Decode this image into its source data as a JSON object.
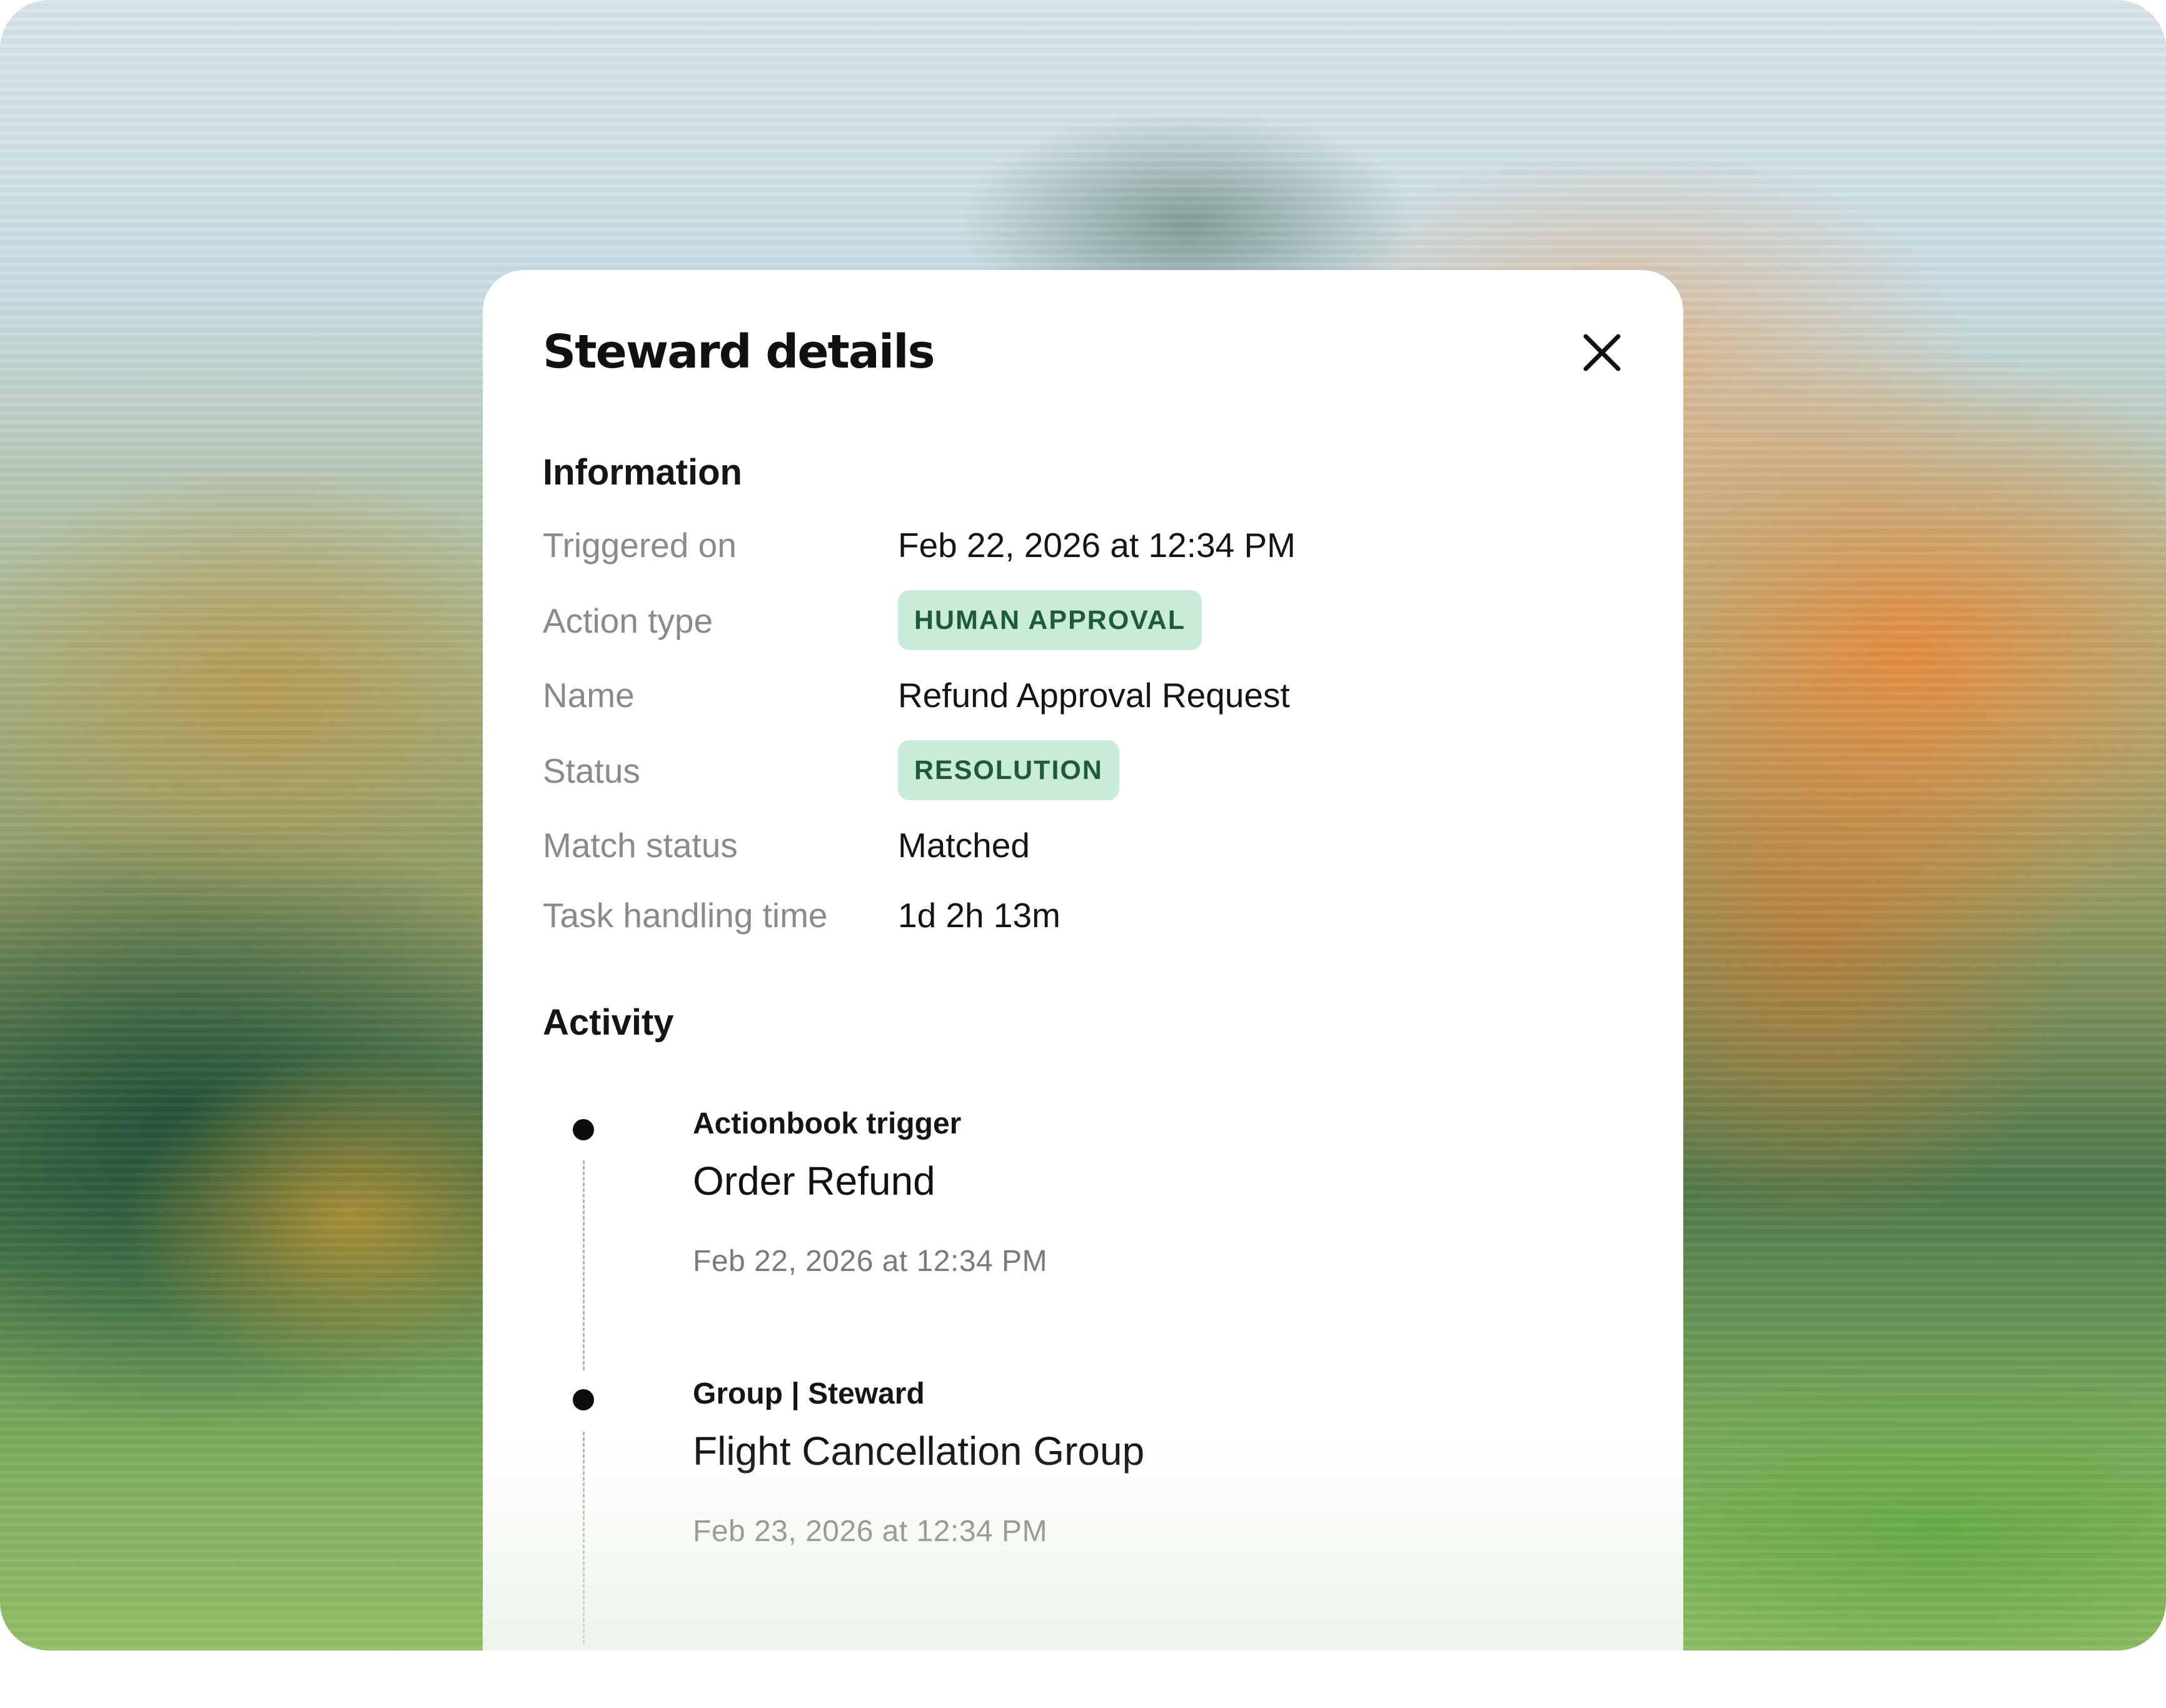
{
  "modal": {
    "title": "Steward details",
    "close_icon": "close-icon"
  },
  "information": {
    "heading": "Information",
    "rows": [
      {
        "label": "Triggered on",
        "value": "Feb 22, 2026 at 12:34 PM"
      },
      {
        "label": "Action type",
        "value": "HUMAN APPROVAL",
        "badge": true
      },
      {
        "label": "Name",
        "value": "Refund Approval Request"
      },
      {
        "label": "Status",
        "value": "RESOLUTION",
        "badge": true
      },
      {
        "label": "Match status",
        "value": "Matched"
      },
      {
        "label": "Task handling time",
        "value": "1d 2h 13m"
      }
    ]
  },
  "activity": {
    "heading": "Activity",
    "items": [
      {
        "kicker": "Actionbook trigger",
        "title": "Order Refund",
        "date": "Feb 22, 2026 at 12:34 PM"
      },
      {
        "kicker": "Group | Steward",
        "title": "Flight Cancellation Group",
        "date": "Feb 23, 2026 at 12:34 PM"
      }
    ]
  },
  "colors": {
    "badge_bg": "#c9ecd8",
    "badge_text": "#1f5a3d",
    "label_gray": "#8a8a8a"
  }
}
